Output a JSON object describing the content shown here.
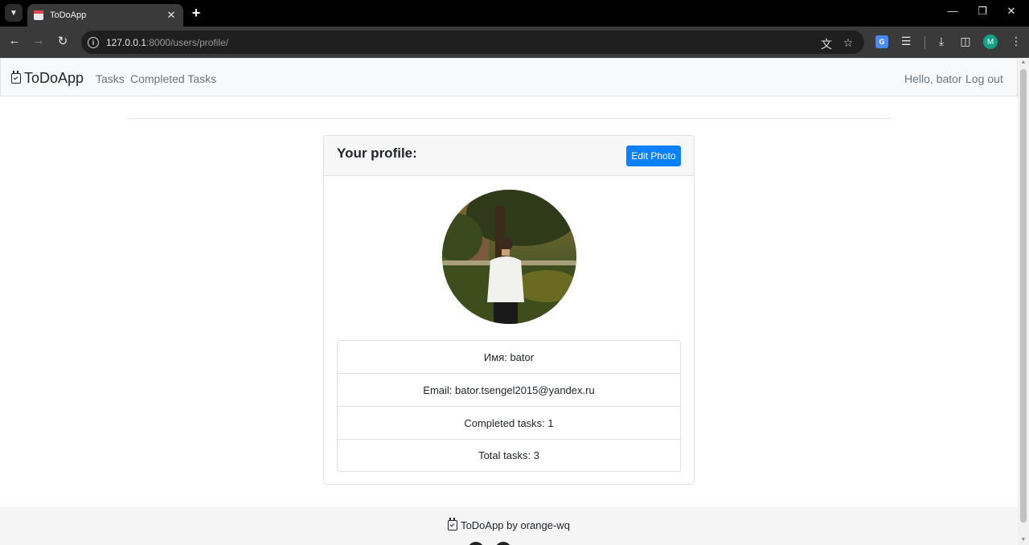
{
  "browser": {
    "tab_title": "ToDoApp",
    "url_host": "127.0.0.1",
    "url_path": ":8000/users/profile/",
    "profile_initial": "M"
  },
  "navbar": {
    "brand": "ToDoApp",
    "links": [
      "Tasks",
      "Completed Tasks"
    ],
    "greeting": "Hello, bator",
    "logout": "Log out"
  },
  "profile_card": {
    "title": "Your profile:",
    "edit_button": "Edit Photo",
    "details": [
      "Имя: bator",
      "Email: bator.tsengel2015@yandex.ru",
      "Completed tasks: 1",
      "Total tasks: 3"
    ]
  },
  "footer": {
    "text": "ToDoApp by orange-wq"
  },
  "colors": {
    "primary": "#0d80fd",
    "navbar_bg": "#f8f9fa",
    "muted_link": "#6c757d"
  }
}
